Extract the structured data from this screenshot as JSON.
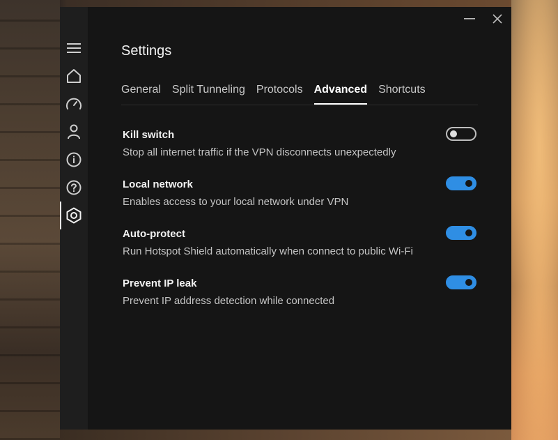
{
  "window": {
    "minimize_icon": "minimize-icon",
    "close_icon": "close-icon"
  },
  "sidebar": {
    "items": [
      {
        "name": "menu",
        "icon": "hamburger-menu-icon",
        "active": false
      },
      {
        "name": "home",
        "icon": "home-icon",
        "active": false
      },
      {
        "name": "speed",
        "icon": "speedometer-icon",
        "active": false
      },
      {
        "name": "account",
        "icon": "user-icon",
        "active": false
      },
      {
        "name": "info",
        "icon": "info-icon",
        "active": false
      },
      {
        "name": "help",
        "icon": "help-icon",
        "active": false
      },
      {
        "name": "settings",
        "icon": "settings-hexagon-icon",
        "active": true
      }
    ]
  },
  "page": {
    "title": "Settings"
  },
  "tabs": [
    {
      "label": "General",
      "active": false
    },
    {
      "label": "Split Tunneling",
      "active": false
    },
    {
      "label": "Protocols",
      "active": false
    },
    {
      "label": "Advanced",
      "active": true
    },
    {
      "label": "Shortcuts",
      "active": false
    }
  ],
  "settings": [
    {
      "title": "Kill switch",
      "description": "Stop all internet traffic if the VPN disconnects unexpectedly",
      "enabled": false
    },
    {
      "title": "Local network",
      "description": "Enables access to your local network under VPN",
      "enabled": true
    },
    {
      "title": "Auto-protect",
      "description": "Run Hotspot Shield automatically when connect to public Wi-Fi",
      "enabled": true
    },
    {
      "title": "Prevent IP leak",
      "description": "Prevent IP address detection while connected",
      "enabled": true
    }
  ],
  "colors": {
    "window_bg": "#151515",
    "sidebar_bg": "#1e1e1e",
    "toggle_on": "#2f8ee4",
    "text_primary": "#f2f2f2",
    "text_secondary": "#c4c4c4"
  }
}
